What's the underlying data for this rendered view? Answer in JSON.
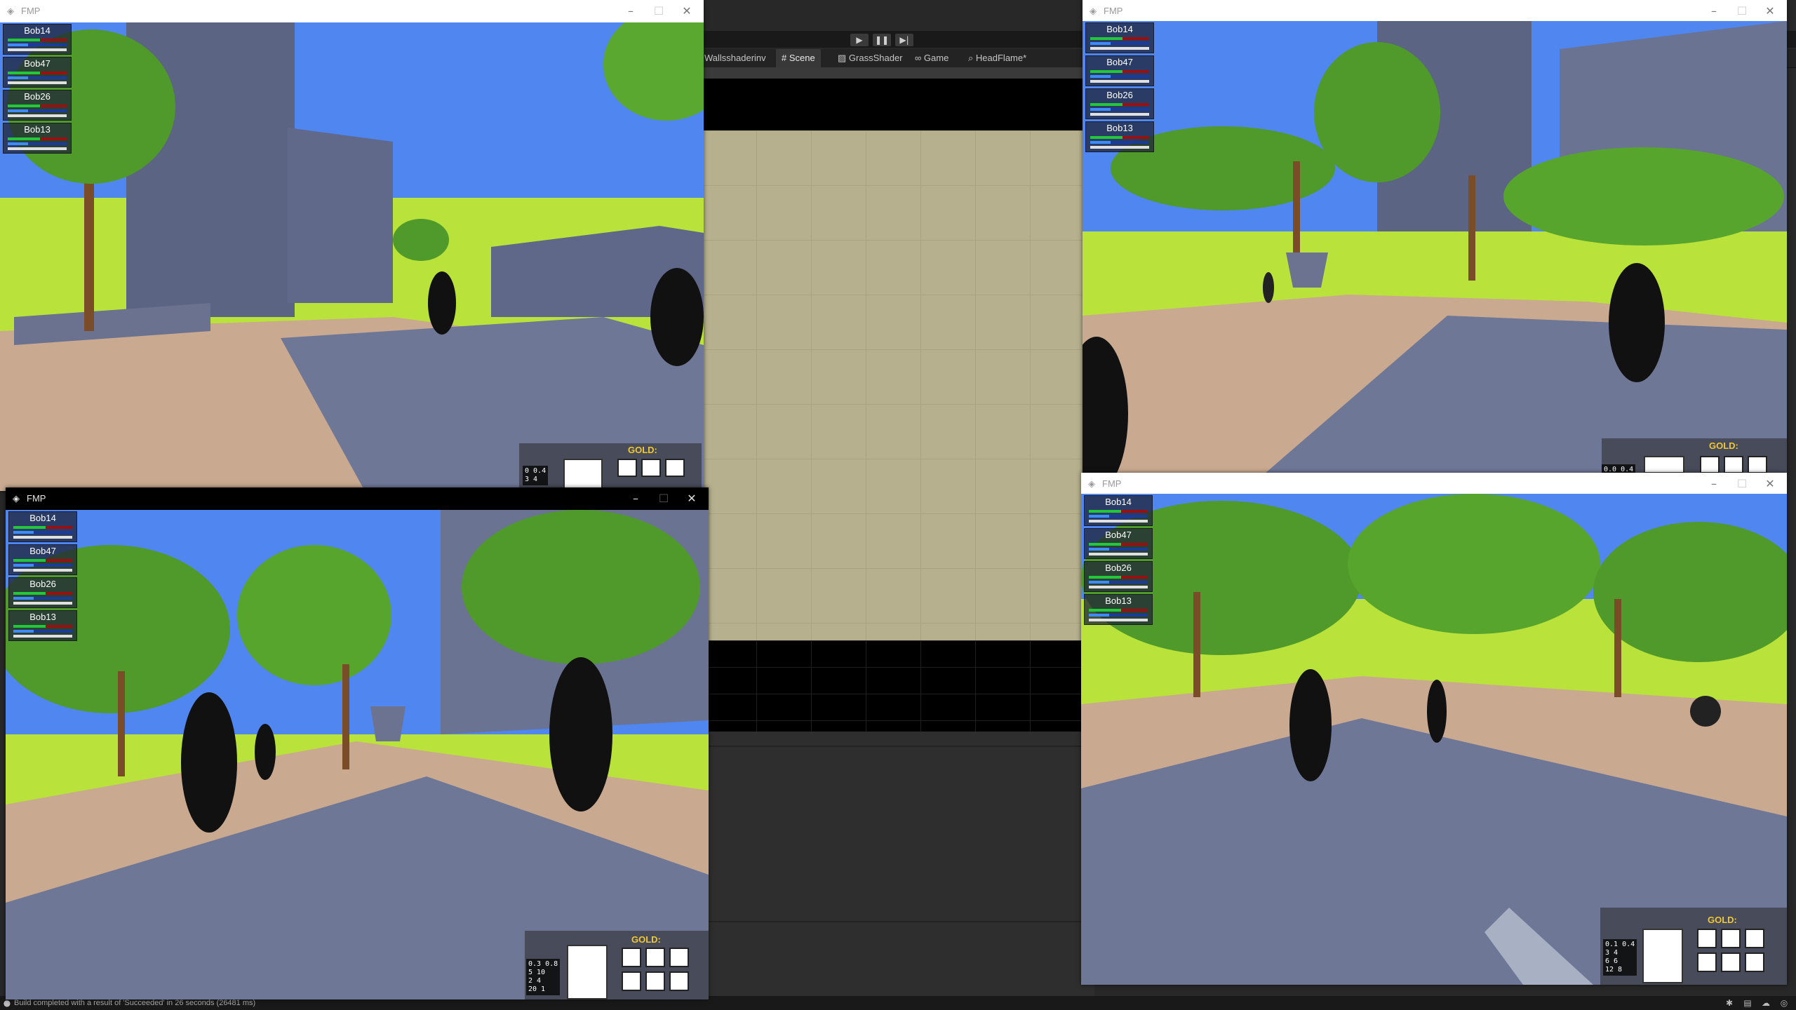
{
  "editor": {
    "toolbar_buttons": [
      "▶",
      "❚❚",
      "▶|"
    ],
    "tabs": [
      {
        "label": "Wallsshaderinv",
        "icon": ""
      },
      {
        "label": "Scene",
        "icon": "#"
      },
      {
        "label": "GrassShader",
        "icon": "▨"
      },
      {
        "label": "Game",
        "icon": "∞"
      },
      {
        "label": "HeadFlame*",
        "icon": "⌕"
      }
    ],
    "status": "Build completed with a result of 'Succeeded' in 26 seconds (26481 ms)"
  },
  "colors": {
    "sky": "#4f86f0",
    "grass": "#b9e23a",
    "ground": "#6f7797",
    "dirt": "#c9a98f",
    "tree": "#4f9a2a",
    "trunk": "#7a4d28",
    "scene_tan": "#b6b08e",
    "hp_back": "#9a1010",
    "hp_fill": "#22c83a",
    "mp_fill": "#3c8cff",
    "gold_label": "#f0c830"
  },
  "windows": [
    {
      "title": "FMP",
      "titlebar_style": "light",
      "party": [
        {
          "name": "Bob14",
          "hp": 0.55,
          "mp": 0.35,
          "xp": 0.0
        },
        {
          "name": "Bob47",
          "hp": 0.55,
          "mp": 0.35,
          "xp": 0.0
        },
        {
          "name": "Bob26",
          "hp": 0.55,
          "mp": 0.35,
          "xp": 0.0
        },
        {
          "name": "Bob13",
          "hp": 0.55,
          "mp": 0.35,
          "xp": 0.0
        }
      ],
      "gold_label": "GOLD:",
      "stats": [
        "0 0.4",
        "3  4"
      ]
    },
    {
      "title": "FMP",
      "titlebar_style": "light",
      "party": [
        {
          "name": "Bob14",
          "hp": 0.55,
          "mp": 0.35,
          "xp": 0.0
        },
        {
          "name": "Bob47",
          "hp": 0.55,
          "mp": 0.35,
          "xp": 0.0
        },
        {
          "name": "Bob26",
          "hp": 0.55,
          "mp": 0.35,
          "xp": 0.0
        },
        {
          "name": "Bob13",
          "hp": 0.55,
          "mp": 0.35,
          "xp": 0.0
        }
      ],
      "gold_label": "GOLD:",
      "stats": [
        "0.0 0.4"
      ]
    },
    {
      "title": "FMP",
      "titlebar_style": "dark",
      "party": [
        {
          "name": "Bob14",
          "hp": 0.55,
          "mp": 0.35,
          "xp": 0.0
        },
        {
          "name": "Bob47",
          "hp": 0.55,
          "mp": 0.35,
          "xp": 0.0
        },
        {
          "name": "Bob26",
          "hp": 0.55,
          "mp": 0.35,
          "xp": 0.0
        },
        {
          "name": "Bob13",
          "hp": 0.55,
          "mp": 0.35,
          "xp": 0.0
        }
      ],
      "gold_label": "GOLD:",
      "stats": [
        "0.3 0.8",
        "5 10",
        "2  4",
        "20 1"
      ]
    },
    {
      "title": "FMP",
      "titlebar_style": "light",
      "party": [
        {
          "name": "Bob14",
          "hp": 0.55,
          "mp": 0.35,
          "xp": 0.0
        },
        {
          "name": "Bob47",
          "hp": 0.55,
          "mp": 0.35,
          "xp": 0.0
        },
        {
          "name": "Bob26",
          "hp": 0.55,
          "mp": 0.35,
          "xp": 0.0
        },
        {
          "name": "Bob13",
          "hp": 0.55,
          "mp": 0.35,
          "xp": 0.0
        }
      ],
      "gold_label": "GOLD:",
      "stats": [
        "0.1 0.4",
        "3  4",
        "6  6",
        "12 8"
      ]
    }
  ]
}
